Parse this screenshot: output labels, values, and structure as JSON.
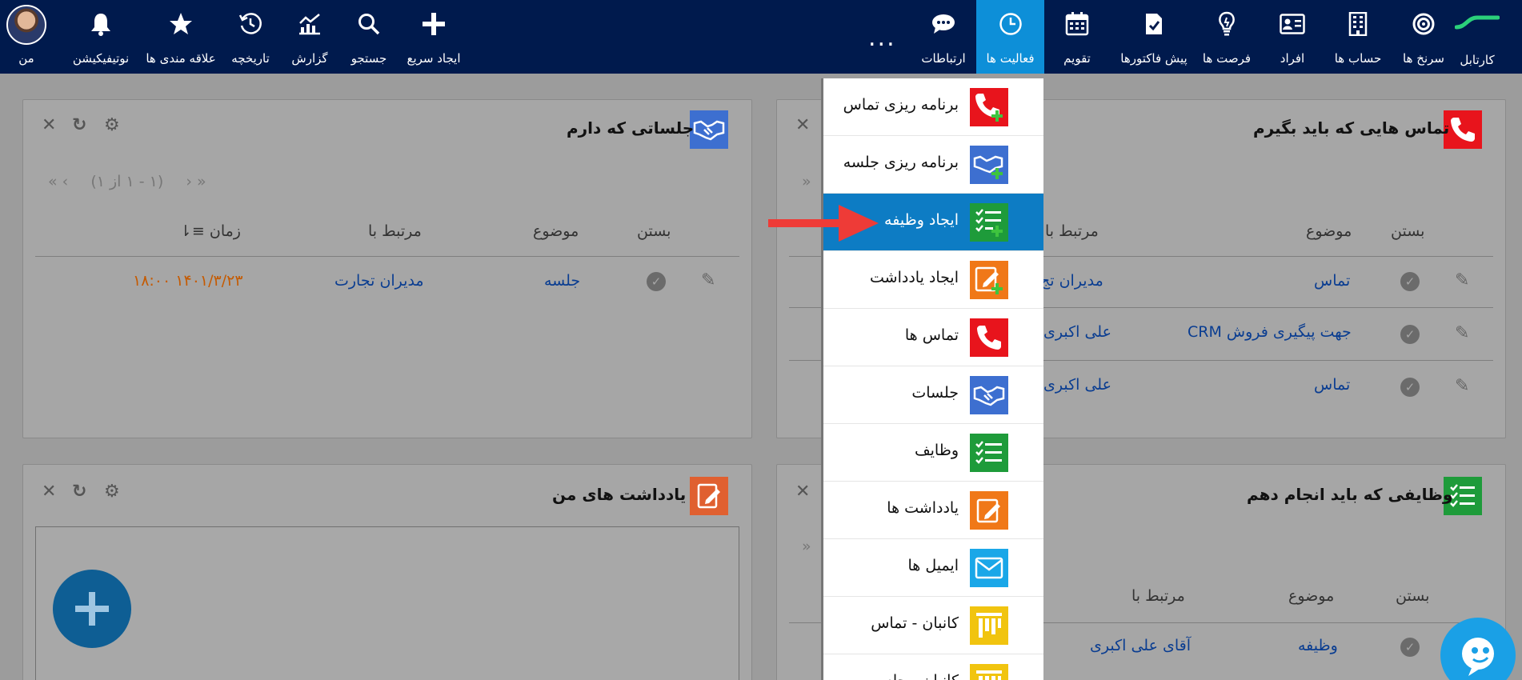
{
  "nav": {
    "brand_label": "کارتابل",
    "items": {
      "funnels": "سرنخ ها",
      "accounts": "حساب ها",
      "persons": "افراد",
      "opportunities": "فرصت ها",
      "invoices": "پیش فاکتورها",
      "calendar": "تقویم",
      "activities": "فعالیت ها",
      "communications": "ارتباطات",
      "quick_create": "ایجاد سریع",
      "search": "جستجو",
      "report": "گزارش",
      "history": "تاریخچه",
      "favorites": "علاقه مندی ها",
      "notifications": "نوتیفیکیشن",
      "me": "من"
    },
    "more": "..."
  },
  "meetings_panel": {
    "title": "جلساتی که دارم",
    "pager": "(۱ - ۱ از ۱)",
    "headers": {
      "close": "بستن",
      "subject": "موضوع",
      "related": "مرتبط با",
      "time": "زمان"
    },
    "rows": [
      {
        "subject": "جلسه",
        "related": "مدیران تجارت",
        "time": "۱۴۰۱/۳/۲۳ ۱۸:۰۰"
      }
    ]
  },
  "calls_panel": {
    "title": "تماس هایی که باید بگیرم",
    "headers": {
      "close": "بستن",
      "subject": "موضوع",
      "related": "مرتبط با"
    },
    "rows": [
      {
        "subject": "تماس",
        "related": "مدیران تج"
      },
      {
        "subject": "جهت پیگیری فروش CRM",
        "related": "علی اکبری"
      },
      {
        "subject": "تماس",
        "related": "علی اکبری"
      }
    ]
  },
  "notes_panel": {
    "title": "یادداشت های من"
  },
  "tasks_panel": {
    "title": "وظایفی که باید انجام دهم",
    "headers": {
      "close": "بستن",
      "subject": "موضوع",
      "related": "مرتبط با"
    },
    "rows": [
      {
        "subject": "وظیفه",
        "related": "آقای علی اکبری"
      }
    ]
  },
  "dropdown": {
    "items": [
      {
        "label": "برنامه ریزی تماس"
      },
      {
        "label": "برنامه ریزی جلسه"
      },
      {
        "label": "ایجاد وظیفه"
      },
      {
        "label": "ایجاد یادداشت"
      },
      {
        "label": "تماس ها"
      },
      {
        "label": "جلسات"
      },
      {
        "label": "وظایف"
      },
      {
        "label": "یادداشت ها"
      },
      {
        "label": "ایمیل ها"
      },
      {
        "label": "کانبان - تماس"
      },
      {
        "label": "کانبان - جلسه"
      }
    ]
  },
  "colors": {
    "nav_bg": "#001a4d",
    "active_tab": "#0d8fd8",
    "call_red": "#e8141c",
    "meeting_blue": "#3d6fd0",
    "task_green": "#1e9b3a",
    "note_orange": "#f07818",
    "email_cyan": "#1aa7e8",
    "kanban_yellow": "#f1c40f"
  }
}
